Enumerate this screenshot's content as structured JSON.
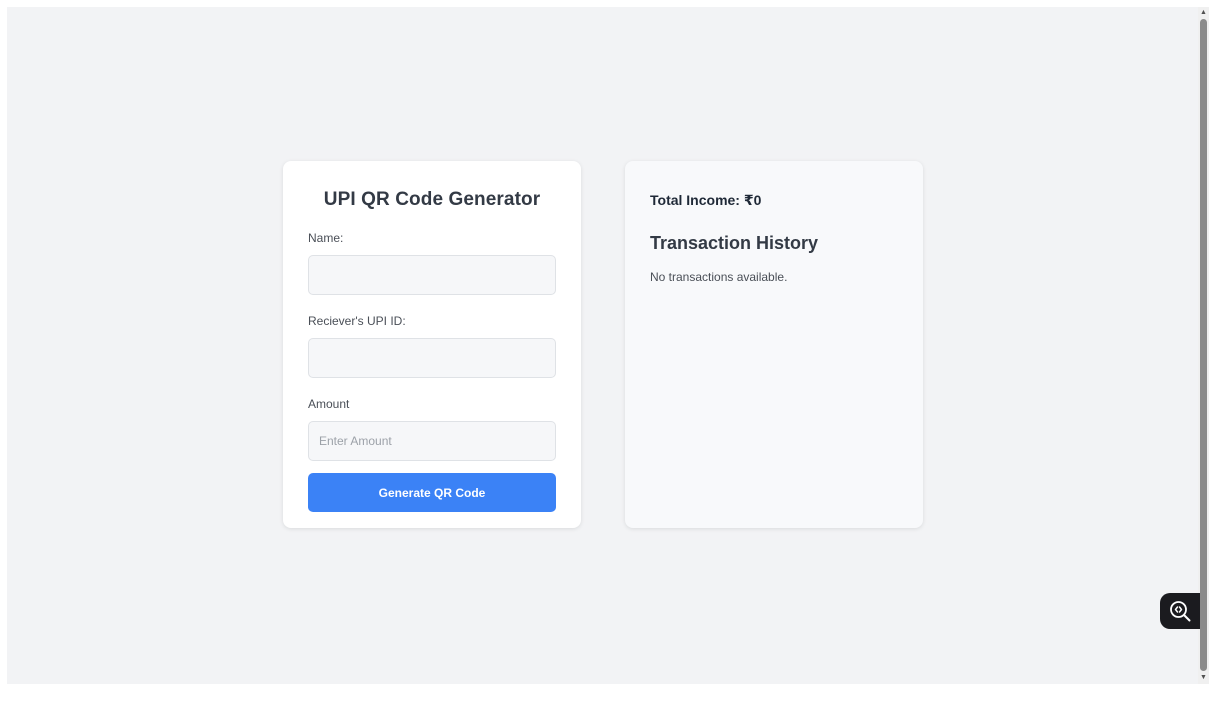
{
  "form": {
    "title": "UPI QR Code Generator",
    "name_label": "Name:",
    "name_value": "",
    "name_placeholder": "",
    "upi_label": "Reciever's UPI ID:",
    "upi_value": "",
    "upi_placeholder": "",
    "amount_label": "Amount",
    "amount_value": "",
    "amount_placeholder": "Enter Amount",
    "submit_label": "Generate QR Code"
  },
  "summary": {
    "total_income": "Total Income: ₹0"
  },
  "history": {
    "title": "Transaction History",
    "empty_message": "No transactions available."
  },
  "icons": {
    "devtools_badge": "inspect-code-icon",
    "scroll_up": "chevron-up-icon",
    "scroll_down": "chevron-down-icon"
  },
  "colors": {
    "page_background": "#f2f3f5",
    "card_background": "#ffffff",
    "history_card_background": "#f8f9fb",
    "primary_button": "#3b82f6",
    "title_text": "#333a45"
  }
}
